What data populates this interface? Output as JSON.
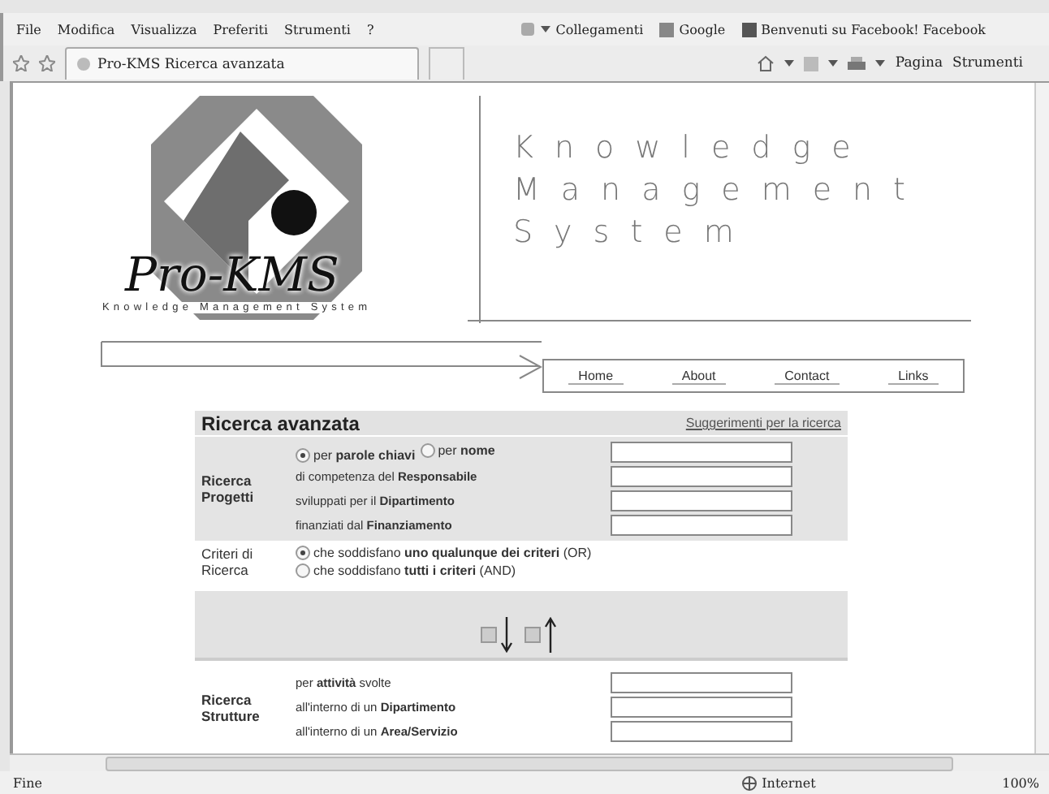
{
  "menu": [
    "File",
    "Modifica",
    "Visualizza",
    "Preferiti",
    "Strumenti",
    "?"
  ],
  "favorites": {
    "label": "Collegamenti",
    "links": [
      "Google",
      "Benvenuti su Facebook! Facebook"
    ]
  },
  "tab": {
    "title": "Pro-KMS Ricerca avanzata"
  },
  "commands": [
    "Pagina",
    "Strumenti"
  ],
  "logo": {
    "name": "Pro-KMS",
    "tagline": "Knowledge Management System",
    "title_lines": [
      "Knowledge",
      "Management",
      "System"
    ]
  },
  "nav": [
    "Home",
    "About",
    "Contact",
    "Links"
  ],
  "search": {
    "title": "Ricerca avanzata",
    "hint_link": "Suggerimenti per la ricerca",
    "projects": {
      "label": "Ricerca Progetti",
      "modes": [
        {
          "label": "per **parole chiavi**",
          "selected": true
        },
        {
          "label": "per **nome**",
          "selected": false
        }
      ],
      "rows": [
        "di competenza del **Responsabile**",
        "sviluppati per il **Dipartimento**",
        "finanziati dal **Finanziamento**"
      ]
    },
    "criteria": {
      "label": "Criteri di Ricerca",
      "options": [
        {
          "label": "che soddisfano **uno qualunque dei criteri** (OR)",
          "selected": true
        },
        {
          "label": "che soddisfano **tutti i criteri** (AND)",
          "selected": false
        }
      ]
    },
    "sort": [
      {
        "kind": "down",
        "checked": false
      },
      {
        "kind": "up",
        "checked": false
      }
    ],
    "structures": {
      "label": "Ricerca Strutture",
      "rows": [
        "per **attività** svolte",
        "all'interno di un **Dipartimento**",
        "all'interno di un **Area/Servizio**"
      ]
    }
  },
  "status": {
    "text": "Fine",
    "zone": "Internet",
    "zoom": "100%"
  }
}
